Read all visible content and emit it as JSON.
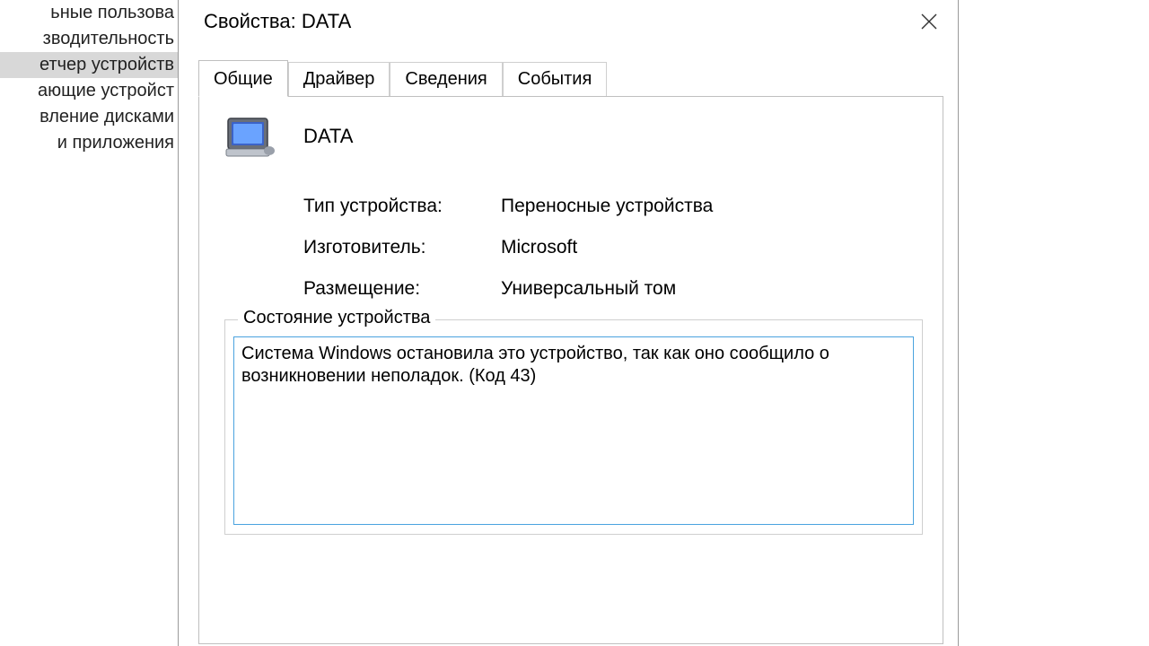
{
  "background_list": {
    "items": [
      {
        "label": "ьные пользова",
        "selected": false
      },
      {
        "label": "зводительность",
        "selected": false
      },
      {
        "label": "етчер устройств",
        "selected": true
      },
      {
        "label": "ающие устройст",
        "selected": false
      },
      {
        "label": "вление дисками",
        "selected": false
      },
      {
        "label": "и приложения",
        "selected": false
      }
    ]
  },
  "dialog": {
    "title": "Свойства: DATA",
    "tabs": [
      {
        "label": "Общие",
        "active": true
      },
      {
        "label": "Драйвер",
        "active": false
      },
      {
        "label": "Сведения",
        "active": false
      },
      {
        "label": "События",
        "active": false
      }
    ],
    "device_name": "DATA",
    "icon": "portable-device-icon",
    "properties": {
      "type_label": "Тип устройства:",
      "type_value": "Переносные устройства",
      "manufacturer_label": "Изготовитель:",
      "manufacturer_value": "Microsoft",
      "location_label": "Размещение:",
      "location_value": "Универсальный том"
    },
    "status": {
      "legend": "Состояние устройства",
      "text": "Система Windows остановила это устройство, так как оно сообщило о возникновении неполадок. (Код 43)"
    }
  }
}
